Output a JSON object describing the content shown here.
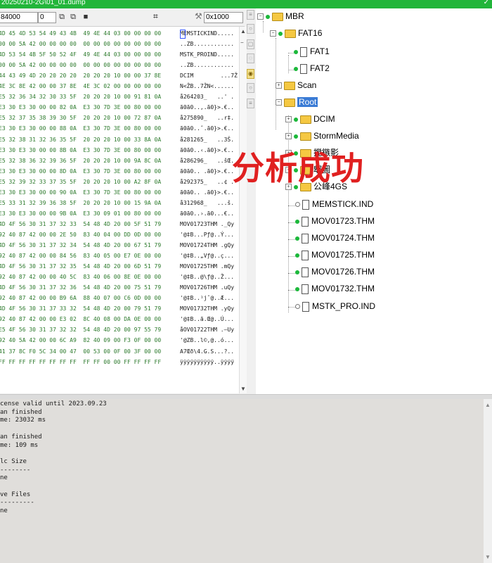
{
  "window": {
    "title": "20250210-2G\\01_01.dump",
    "chevron": "✓"
  },
  "toolbar": {
    "offset": "84000",
    "value2": "0",
    "goto": "0x1000"
  },
  "hex_rows": [
    [
      "4D 45 4D 53 54 49 43 4B  49 4E 44 03 00 00 00 00",
      "MEMSTICKIND....."
    ],
    [
      "00 00 5A 42 00 00 00 00  00 00 00 00 00 00 00 00",
      "..ZB............"
    ],
    [
      "4D 53 54 4B 5F 50 52 4F  49 4E 44 03 00 00 00 00",
      "MSTK_PROIND....."
    ],
    [
      "00 00 5A 42 00 00 00 00  00 00 00 00 00 00 00 00",
      "..ZB............"
    ],
    [
      "44 43 49 4D 20 20 20 20  20 20 20 10 00 00 37 8E",
      "DCIM        ...7Ž"
    ],
    [
      "4E 3C 8E 42 00 00 37 8E  4E 3C 02 00 00 00 00 00",
      "N<ŽB..7ŽN<......"
    ],
    [
      "E5 32 36 34 32 30 33 5F  20 20 20 10 00 91 81 0A",
      "å264203_   ..' ."
    ],
    [
      "E3 30 E3 30 00 00 82 0A  E3 30 7D 3E 00 80 00 00",
      "ã0ã0..‚.ã0}>.€.."
    ],
    [
      "E5 32 37 35 38 39 30 5F  20 20 20 10 00 72 87 0A",
      "å275890_   ..r‡."
    ],
    [
      "E3 30 E3 30 00 00 88 0A  E3 30 7D 3E 00 80 00 00",
      "ã0ã0..ˆ.ã0}>.€.."
    ],
    [
      "E5 32 38 31 32 36 35 5F  20 20 20 10 00 33 8A 0A",
      "å281265_   ..3Š."
    ],
    [
      "E3 30 E3 30 00 00 8B 0A  E3 30 7D 3E 00 80 00 00",
      "ã0ã0..‹.ã0}>.€.."
    ],
    [
      "E5 32 38 36 32 39 36 5F  20 20 20 10 00 9A 8C 0A",
      "å286296_   ..šŒ."
    ],
    [
      "E3 30 E3 30 00 00 8D 0A  E3 30 7D 3E 00 80 00 00",
      "ã0ã0.. .ã0}>.€.."
    ],
    [
      "E5 32 39 32 33 37 35 5F  20 20 20 10 00 A2 8F 0A",
      "å292375_   ..¢ ."
    ],
    [
      "E3 30 E3 30 00 00 90 0A  E3 30 7D 3E 00 80 00 00",
      "ã0ã0.. .ã0}>.€.."
    ],
    [
      "E5 33 31 32 39 36 38 5F  20 20 20 10 00 15 9A 0A",
      "å312968_   ...š."
    ],
    [
      "E3 30 E3 30 00 00 9B 0A  E3 30 09 01 00 80 00 00",
      "ã0ã0..›.ã0...€.."
    ],
    [
      "4D 4F 56 30 31 37 32 33  54 48 4D 20 00 5F 51 79",
      "MOV01723THM ._Qy"
    ],
    [
      "92 40 87 42 00 00 2E 50  83 40 04 00 DD 0D 00 00",
      "'@‡B...Pƒ@..Ý..."
    ],
    [
      "4D 4F 56 30 31 37 32 34  54 48 4D 20 00 67 51 79",
      "MOV01724THM .gQy"
    ],
    [
      "92 40 87 42 00 00 84 56  83 40 05 00 E7 0E 00 00",
      "'@‡B..„Vƒ@..ç..."
    ],
    [
      "4D 4F 56 30 31 37 32 35  54 48 4D 20 00 6D 51 79",
      "MOV01725THM .mQy"
    ],
    [
      "92 40 87 42 00 00 40 5C  83 40 06 00 8E 0E 00 00",
      "'@‡B..@\\ƒ@..Ž..."
    ],
    [
      "4D 4F 56 30 31 37 32 36  54 48 4D 20 00 75 51 79",
      "MOV01726THM .uQy"
    ],
    [
      "92 40 87 42 00 00 B9 6A  88 40 07 00 C6 0D 00 00",
      "'@‡B..¹jˆ@..Æ..."
    ],
    [
      "4D 4F 56 30 31 37 33 32  54 48 4D 20 00 79 51 79",
      "MOV01732THM .yQy"
    ],
    [
      "92 40 87 42 00 00 E3 02  8C 40 08 00 DA 0E 00 00",
      "'@‡B..ã.Œ@..Ú..."
    ],
    [
      "E5 4F 56 30 31 37 32 32  54 48 4D 20 00 97 55 79",
      "åOV01722THM .—Uy"
    ],
    [
      "92 40 5A 42 00 00 6C A9  82 40 09 00 F3 0F 00 00",
      "'@ZB..l©‚@..ó..."
    ],
    [
      "41 37 8C F0 5C 34 00 47  00 53 00 0F 00 3F 00 00",
      "A7Œð\\4.G.S...?.."
    ],
    [
      "FF FF FF FF FF FF FF FF  FF FF 00 00 FF FF FF FF",
      "ÿÿÿÿÿÿÿÿÿÿ..ÿÿÿÿ"
    ]
  ],
  "tree": {
    "mbr": "MBR",
    "fat16": "FAT16",
    "fat1": "FAT1",
    "fat2": "FAT2",
    "scan": "Scan",
    "root": "Root",
    "dcim": "DCIM",
    "stormmedia": "StormMedia",
    "partial1": "搅鏃影",
    "partial2": "郫圖",
    "partial3": "公峰4GS",
    "files": [
      "MEMSTICK.IND",
      "MOV01723.THM",
      "MOV01724.THM",
      "MOV01725.THM",
      "MOV01726.THM",
      "MOV01732.THM",
      "MSTK_PRO.IND"
    ]
  },
  "overlay_text": "分析成功",
  "log_lines": [
    "cense valid until 2023.09.23",
    "an finished",
    "me: 23032 ms",
    "",
    "an finished",
    "me: 109 ms",
    "",
    "lc Size",
    "--------",
    "ne",
    "",
    "ve Files",
    "---------",
    "ne"
  ],
  "colors": {
    "titlebar": "#22b53a",
    "accent": "#3a7bd5",
    "overlay": "#e02020"
  }
}
